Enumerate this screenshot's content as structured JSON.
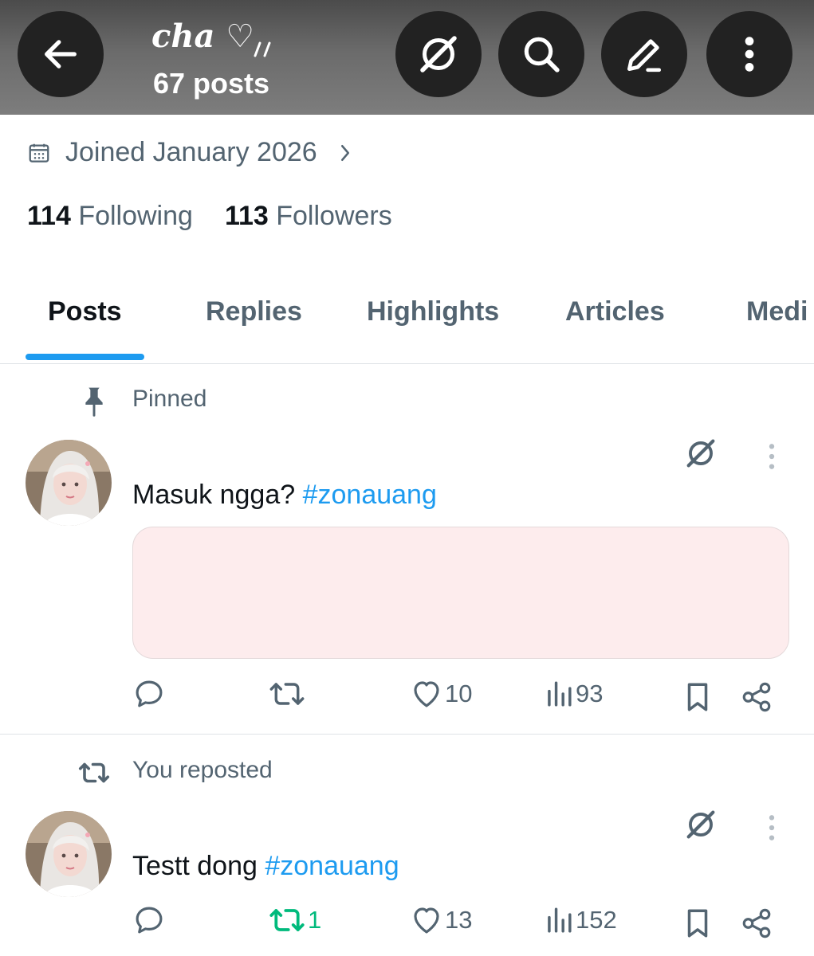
{
  "header": {
    "display_name": "cha ♡",
    "post_count": "67 posts",
    "icons": [
      "back-arrow-icon",
      "grok-icon",
      "search-icon",
      "edit-icon",
      "more-vertical-icon"
    ]
  },
  "profile": {
    "joined": "Joined January 2026",
    "following_count": "114",
    "following_label": "Following",
    "followers_count": "113",
    "followers_label": "Followers"
  },
  "tabs": [
    {
      "label": "Posts",
      "active": true
    },
    {
      "label": "Replies",
      "active": false
    },
    {
      "label": "Highlights",
      "active": false
    },
    {
      "label": "Articles",
      "active": false
    },
    {
      "label": "Medi",
      "active": false
    }
  ],
  "posts": [
    {
      "context": "Pinned",
      "text": "Masuk ngga? ",
      "hashtag": "#zonauang",
      "has_media": true,
      "replies": "",
      "reposts": "",
      "likes": "10",
      "views": "93"
    },
    {
      "context": "You reposted",
      "text": "Testt dong ",
      "hashtag": "#zonauang",
      "has_media": false,
      "replies": "",
      "reposts": "1",
      "likes": "13",
      "views": "152"
    }
  ],
  "colors": {
    "accent": "#1d9bf0",
    "muted": "#536471",
    "repost_green": "#00ba7c",
    "media_bg": "#fdeced"
  }
}
